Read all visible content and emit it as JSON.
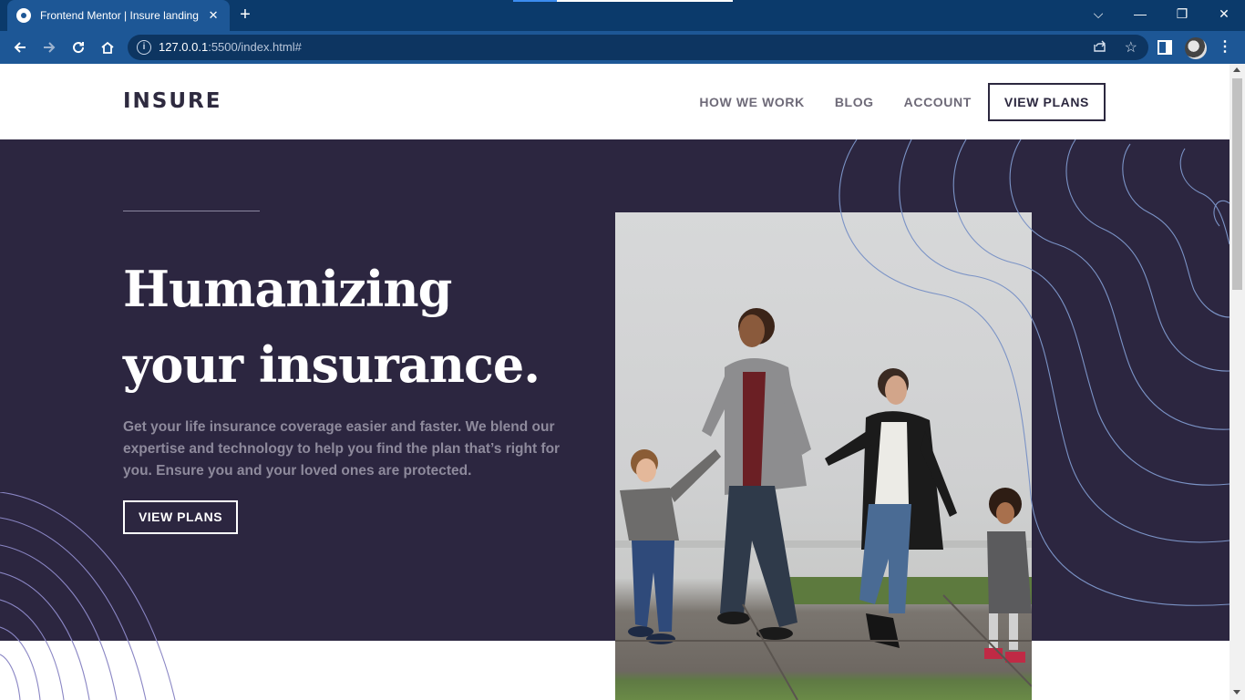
{
  "browser": {
    "tab_title": "Frontend Mentor | Insure landing page",
    "tab_close": "✕",
    "new_tab": "+",
    "url_host": "127.0.0.1",
    "url_rest": ":5500/index.html#",
    "window_controls": [
      "⌵",
      "—",
      "❐",
      "✕"
    ]
  },
  "site": {
    "logo": "INSURE",
    "nav": [
      "HOW WE WORK",
      "BLOG",
      "ACCOUNT"
    ],
    "nav_cta": "VIEW PLANS"
  },
  "hero": {
    "title_line1": "Humanizing",
    "title_line2": "your insurance.",
    "text": "Get your life insurance coverage easier and faster. We blend our expertise and technology to help you find the plan that’s right for you. Ensure you and your loved ones are protected.",
    "cta": "VIEW PLANS"
  },
  "colors": {
    "hero_bg": "#2c2640",
    "browser_bar": "#0b3a6b",
    "toolbar": "#1d5796",
    "curve_stroke": "#7b93c6"
  },
  "icons": [
    "globe-icon",
    "close-icon",
    "plus-icon",
    "back-icon",
    "forward-icon",
    "reload-icon",
    "home-icon",
    "info-icon",
    "share-icon",
    "star-icon",
    "side-panel-icon",
    "profile-avatar",
    "kebab-menu-icon"
  ]
}
